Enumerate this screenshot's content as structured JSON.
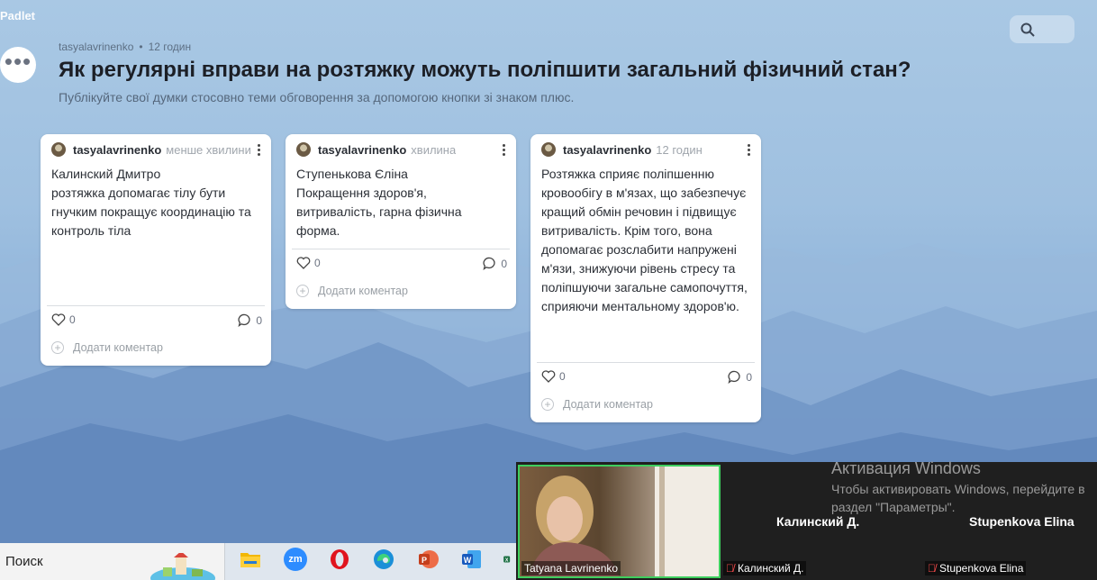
{
  "app": {
    "logo": "Padlet"
  },
  "header": {
    "author": "tasyalavrinenko",
    "time": "12 годин",
    "title": "Як регулярні вправи на розтяжку можуть поліпшити загальний фізичний стан?",
    "subtitle": "Публікуйте свої думки стосовно теми обговорення за допомогою кнопки зі знаком плюс."
  },
  "posts": [
    {
      "author": "tasyalavrinenko",
      "time": "менше хвилини",
      "body": "    Калинский  Дмитро\nрозтяжка допомагає тілу бути гнучким покращує координацію та контроль тіла",
      "likes": "0",
      "comments": "0",
      "add_comment": "Додати коментар"
    },
    {
      "author": "tasyalavrinenko",
      "time": "хвилина",
      "body": "Ступенькова Єліна\nПокращення здоров'я, витривалість, гарна фізична форма.",
      "likes": "0",
      "comments": "0",
      "add_comment": "Додати коментар"
    },
    {
      "author": "tasyalavrinenko",
      "time": "12 годин",
      "body": "Розтяжка сприяє поліпшенню кровообігу в м'язах, що забезпечує кращий обмін речовин і підвищує витривалість. Крім того, вона допомагає розслабити напружені м'язи, знижуючи рівень стресу та поліпшуючи загальне самопочуття, сприяючи ментальному здоров'ю.",
      "likes": "0",
      "comments": "0",
      "add_comment": "Додати коментар"
    }
  ],
  "taskbar": {
    "search_label": "Поиск",
    "apps": [
      {
        "icon": "file-explorer-icon",
        "color": "#f2b705"
      },
      {
        "icon": "zoom-icon",
        "color": "#2d8cff",
        "label": "zm"
      },
      {
        "icon": "opera-icon",
        "color": "#e0141e"
      },
      {
        "icon": "edge-icon",
        "color": "#1b8fd8"
      },
      {
        "icon": "powerpoint-icon",
        "color": "#d04423"
      },
      {
        "icon": "word-icon",
        "color": "#2b5cad"
      },
      {
        "icon": "excel-icon",
        "color": "#1d7044"
      }
    ]
  },
  "video": {
    "self_name": "Tatyana Lavrinenko",
    "participants": [
      {
        "display": "Калинский Д.",
        "label": "Калинский Д."
      },
      {
        "display": "Stupenkova Elina",
        "label": "Stupenkova Elina"
      }
    ]
  },
  "watermark": {
    "title": "Активация Windows",
    "text": "Чтобы активировать Windows, перейдите в раздел \"Параметры\"."
  }
}
